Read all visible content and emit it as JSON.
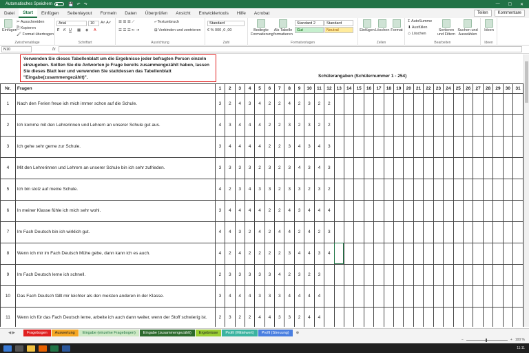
{
  "titlebar": {
    "autosave": "Automatisches Speichern",
    "toggle_state": "off"
  },
  "ribbon_tabs": [
    "Datei",
    "Start",
    "Einfügen",
    "Seitenlayout",
    "Formeln",
    "Daten",
    "Überprüfen",
    "Ansicht",
    "Entwicklertools",
    "Hilfe",
    "Acrobat"
  ],
  "share_label": "Teilen",
  "comments_label": "Kommentare",
  "ribbon": {
    "paste": "Einfügen",
    "cut": "Ausschneiden",
    "copy": "Kopieren",
    "format_painter": "Format übertragen",
    "clipboard_label": "Zwischenablage",
    "font_name": "Arial",
    "font_size": "10",
    "font_label": "Schriftart",
    "wrap_text": "Textumbruch",
    "merge_center": "Verbinden und zentrieren",
    "alignment_label": "Ausrichtung",
    "number_format": "Standard",
    "number_label": "Zahl",
    "cond_format": "Bedingte Formatierung",
    "as_table": "Als Tabelle formatieren",
    "style1": "Standard 2",
    "style2": "Standard",
    "style3": "Gut",
    "style4": "Neutral",
    "styles_label": "Formatvorlagen",
    "insert": "Einfügen",
    "delete": "Löschen",
    "format": "Format",
    "cells_label": "Zellen",
    "autosum": "AutoSumme",
    "fill": "Ausfüllen",
    "clear": "Löschen",
    "sort_filter": "Sortieren und Filtern",
    "find_select": "Suchen und Auswählen",
    "editing_label": "Bearbeiten",
    "ideas": "Ideen",
    "ideas_label": "Ideen"
  },
  "formula_bar": {
    "name_box": "N10",
    "fx": "fx"
  },
  "note": "Verwenden Sie dieses Tabellenblatt um die Ergebnisse jeder befragten Person einzeln\neinzugeben. Sollten Sie die Antworten je Frage bereits zusammengezählt haben, lassen\nSie dieses Blatt leer und verwenden Sie stattdessen das Tabellenblatt\n\"Eingabe(zusammengezählt)\".",
  "header_title": "Schülerangaben (Schülernummer 1 - 254)",
  "col_nr": "Nr.",
  "col_fragen": "Fragen",
  "student_numbers": [
    "1",
    "2",
    "3",
    "4",
    "5",
    "6",
    "7",
    "8",
    "9",
    "10",
    "11",
    "12",
    "13",
    "14",
    "15",
    "16",
    "17",
    "18",
    "19",
    "20",
    "21",
    "22",
    "23",
    "24",
    "25",
    "26",
    "27",
    "28",
    "29",
    "30",
    "31"
  ],
  "rows": [
    {
      "nr": "1",
      "frage": "Nach den Ferien freue ich mich immer schon auf die Schule.",
      "vals": [
        "3",
        "2",
        "4",
        "3",
        "4",
        "2",
        "2",
        "4",
        "2",
        "3",
        "2",
        "2"
      ]
    },
    {
      "nr": "2",
      "frage": "Ich komme mit den Lehrerinnen und Lehrern an unserer Schule gut aus.",
      "vals": [
        "4",
        "3",
        "4",
        "4",
        "4",
        "2",
        "2",
        "3",
        "2",
        "3",
        "2",
        "2"
      ]
    },
    {
      "nr": "3",
      "frage": "Ich gehe sehr gerne zur Schule.",
      "vals": [
        "3",
        "4",
        "4",
        "4",
        "4",
        "2",
        "2",
        "3",
        "4",
        "3",
        "4",
        "3"
      ]
    },
    {
      "nr": "4",
      "frage": "Mit den Lehrerinnen und Lehrern an unserer Schule bin ich sehr zufrieden.",
      "vals": [
        "3",
        "3",
        "3",
        "3",
        "2",
        "3",
        "2",
        "3",
        "4",
        "3",
        "4",
        "3"
      ]
    },
    {
      "nr": "5",
      "frage": "Ich bin stolz auf meine Schule.",
      "vals": [
        "4",
        "2",
        "3",
        "4",
        "3",
        "3",
        "2",
        "3",
        "3",
        "2",
        "3",
        "2"
      ]
    },
    {
      "nr": "6",
      "frage": "In meiner Klasse fühle ich mich sehr wohl.",
      "vals": [
        "3",
        "4",
        "4",
        "4",
        "4",
        "2",
        "2",
        "4",
        "3",
        "4",
        "4",
        "4"
      ]
    },
    {
      "nr": "7",
      "frage": "Im Fach Deutsch bin ich wirklich gut.",
      "vals": [
        "4",
        "4",
        "3",
        "2",
        "4",
        "2",
        "4",
        "4",
        "2",
        "4",
        "2",
        "3"
      ]
    },
    {
      "nr": "8",
      "frage": "Wenn ich mir im Fach Deutsch Mühe gebe, dann kann ich es auch.",
      "vals": [
        "4",
        "2",
        "4",
        "2",
        "2",
        "2",
        "2",
        "3",
        "4",
        "4",
        "3",
        "4"
      ]
    },
    {
      "nr": "9",
      "frage": "Im Fach Deutsch lerne ich schnell.",
      "vals": [
        "2",
        "3",
        "3",
        "3",
        "3",
        "3",
        "4",
        "2",
        "3",
        "2",
        "3",
        ""
      ]
    },
    {
      "nr": "10",
      "frage": "Das Fach Deutsch fällt mir leichter als den meisten anderen in der Klasse.",
      "vals": [
        "3",
        "4",
        "4",
        "4",
        "3",
        "3",
        "3",
        "4",
        "4",
        "4",
        "4",
        ""
      ]
    },
    {
      "nr": "11",
      "frage": "Wenn ich für das Fach Deutsch lerne, arbeite ich auch dann weiter, wenn der Stoff schwierig ist.",
      "vals": [
        "2",
        "3",
        "2",
        "2",
        "4",
        "4",
        "3",
        "3",
        "2",
        "4",
        "4",
        ""
      ]
    }
  ],
  "sheet_tabs": [
    {
      "label": "Fragebogen",
      "color": "#e02020",
      "text": "#ffffff"
    },
    {
      "label": "Auswertung",
      "color": "#f5a623",
      "text": "#222222"
    },
    {
      "label": "Eingabe (einzelne Fragebogen)",
      "color": "#cde8c4",
      "text": "#217346"
    },
    {
      "label": "Eingabe (zusammengezählt)",
      "color": "#2d6a2d",
      "text": "#ffffff"
    },
    {
      "label": "Ergebnisse",
      "color": "#9acd32",
      "text": "#222222"
    },
    {
      "label": "Profil (Mittelwert)",
      "color": "#3bb3a0",
      "text": "#ffffff"
    },
    {
      "label": "Profil (Streuung)",
      "color": "#4a7fe0",
      "text": "#ffffff"
    }
  ],
  "status": {
    "zoom": "100 %"
  },
  "taskbar": {
    "time": "11:11"
  }
}
